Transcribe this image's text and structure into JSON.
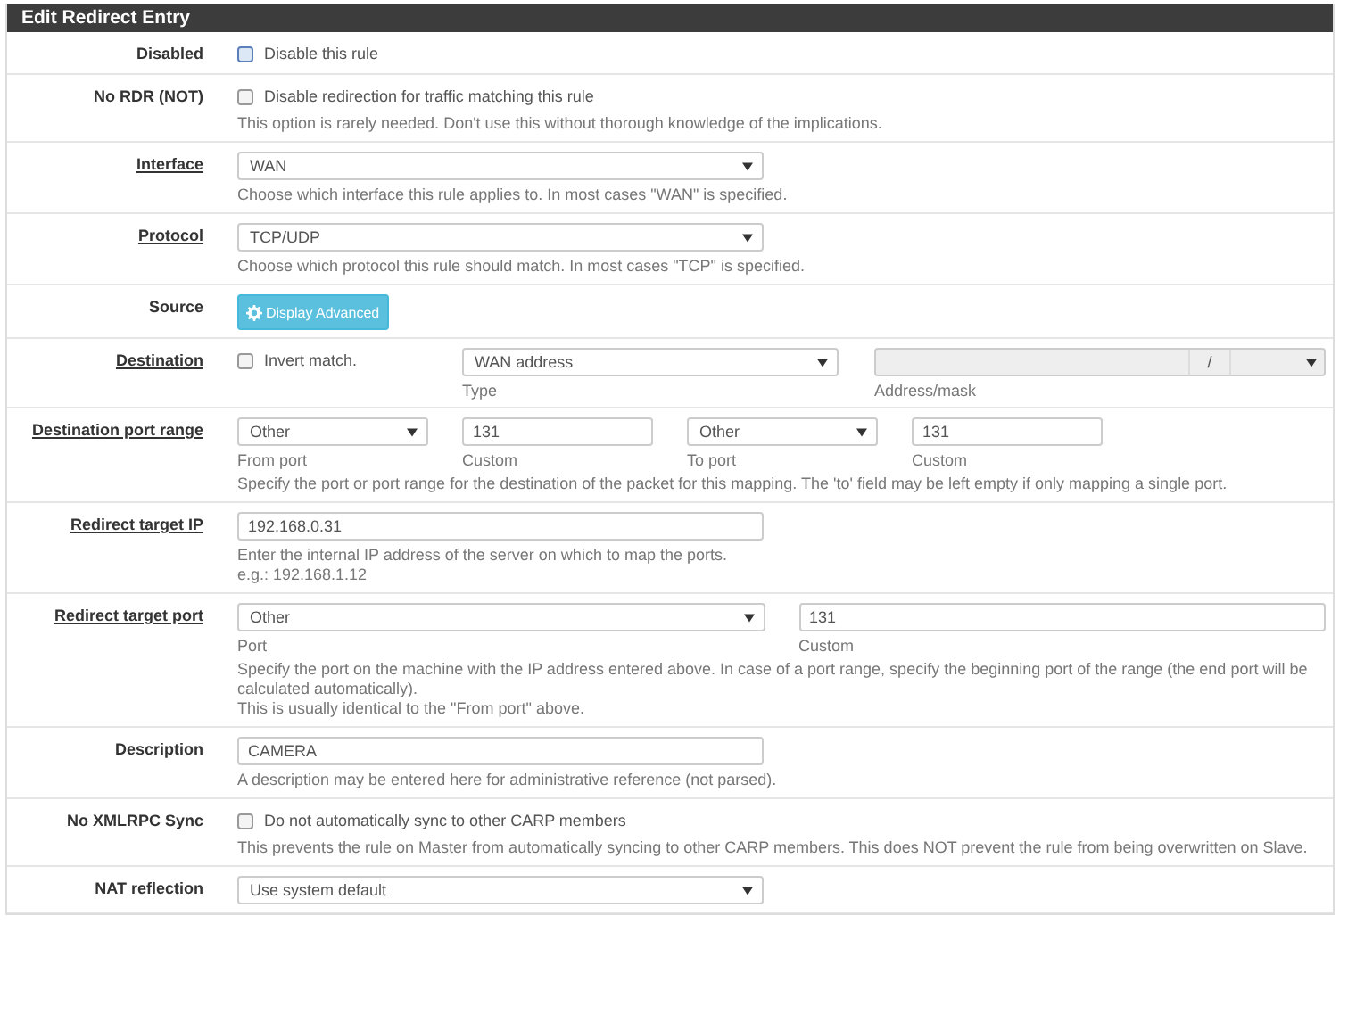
{
  "panel": {
    "title": "Edit Redirect Entry"
  },
  "rows": [
    {
      "label": "Disabled",
      "link": false,
      "controls": [
        {
          "kind": "checkbox",
          "text": "Disable this rule",
          "checked": false,
          "focused": true
        }
      ]
    },
    {
      "label": "No RDR (NOT)",
      "link": false,
      "controls": [
        {
          "kind": "checkbox",
          "text": "Disable redirection for traffic matching this rule",
          "checked": false,
          "focused": false
        }
      ],
      "help": [
        "This option is rarely needed. Don't use this without thorough knowledge of the implications."
      ]
    },
    {
      "label": "Interface",
      "link": true,
      "controls": [
        {
          "kind": "select",
          "value": "WAN"
        }
      ],
      "help": [
        "Choose which interface this rule applies to. In most cases \"WAN\" is specified."
      ]
    },
    {
      "label": "Protocol",
      "link": true,
      "controls": [
        {
          "kind": "select",
          "value": "TCP/UDP"
        }
      ],
      "help": [
        "Choose which protocol this rule should match. In most cases \"TCP\" is specified."
      ]
    },
    {
      "label": "Source",
      "link": false,
      "controls": [
        {
          "kind": "button",
          "text": "Display Advanced"
        }
      ]
    },
    {
      "label": "Destination",
      "link": true,
      "controls": [
        {
          "kind": "checkbox",
          "text": "Invert match.",
          "checked": false,
          "focused": false
        },
        {
          "kind": "select",
          "value": "WAN address",
          "caption": "Type"
        },
        {
          "kind": "address",
          "separator": "/",
          "caption": "Address/mask"
        }
      ]
    },
    {
      "label": "Destination port range",
      "link": true,
      "controls": [
        {
          "kind": "select",
          "value": "Other",
          "caption": "From port"
        },
        {
          "kind": "input",
          "value": "131",
          "caption": "Custom"
        },
        {
          "kind": "select",
          "value": "Other",
          "caption": "To port"
        },
        {
          "kind": "input",
          "value": "131",
          "caption": "Custom"
        }
      ],
      "help": [
        "Specify the port or port range for the destination of the packet for this mapping. The 'to' field may be left empty if only mapping a single port."
      ]
    },
    {
      "label": "Redirect target IP",
      "link": true,
      "controls": [
        {
          "kind": "input",
          "value": "192.168.0.31"
        }
      ],
      "help": [
        "Enter the internal IP address of the server on which to map the ports.",
        "e.g.: 192.168.1.12"
      ]
    },
    {
      "label": "Redirect target port",
      "link": true,
      "controls": [
        {
          "kind": "select",
          "value": "Other",
          "caption": "Port"
        },
        {
          "kind": "input",
          "value": "131",
          "caption": "Custom"
        }
      ],
      "help": [
        "Specify the port on the machine with the IP address entered above. In case of a port range, specify the beginning port of the range (the end port will be calculated automatically).",
        "This is usually identical to the \"From port\" above."
      ]
    },
    {
      "label": "Description",
      "link": false,
      "controls": [
        {
          "kind": "input",
          "value": "CAMERA"
        }
      ],
      "help": [
        "A description may be entered here for administrative reference (not parsed)."
      ]
    },
    {
      "label": "No XMLRPC Sync",
      "link": false,
      "controls": [
        {
          "kind": "checkbox",
          "text": "Do not automatically sync to other CARP members",
          "checked": false,
          "focused": false
        }
      ],
      "help": [
        "This prevents the rule on Master from automatically syncing to other CARP members. This does NOT prevent the rule from being overwritten on Slave."
      ]
    },
    {
      "label": "NAT reflection",
      "link": false,
      "controls": [
        {
          "kind": "select",
          "value": "Use system default"
        }
      ]
    }
  ]
}
